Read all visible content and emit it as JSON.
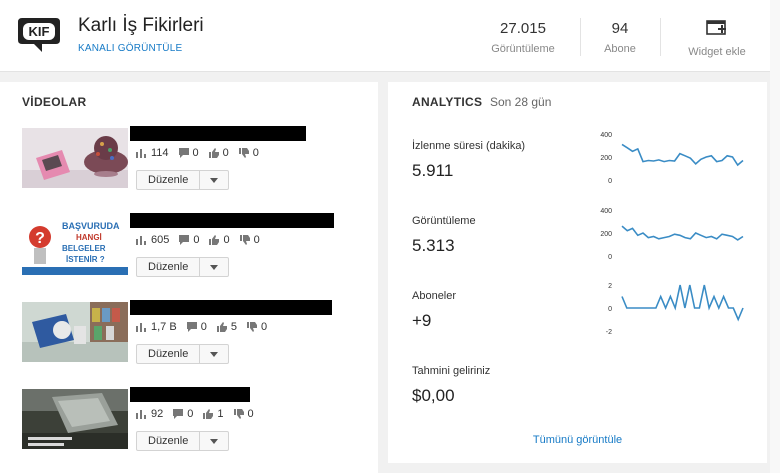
{
  "header": {
    "channel_name": "Karlı İş Fikirleri",
    "view_channel_link": "KANALI GÖRÜNTÜLE",
    "views": {
      "value": "27.015",
      "label": "Görüntüleme"
    },
    "subscribers": {
      "value": "94",
      "label": "Abone"
    },
    "widget_label": "Widget ekle"
  },
  "videos": {
    "title": "VİDEOLAR",
    "edit_label": "Düzenle",
    "items": [
      {
        "views": "114",
        "comments": "0",
        "likes": "0",
        "dislikes": "0"
      },
      {
        "views": "605",
        "comments": "0",
        "likes": "0",
        "dislikes": "0",
        "thumb_text": [
          "BAŞVURUDA",
          "HANGİ",
          "BELGELER",
          "İSTENİR ?"
        ]
      },
      {
        "views": "1,7 B",
        "comments": "0",
        "likes": "5",
        "dislikes": "0"
      },
      {
        "views": "92",
        "comments": "0",
        "likes": "1",
        "dislikes": "0"
      }
    ]
  },
  "analytics": {
    "title": "ANALYTICS",
    "period": "Son 28 gün",
    "see_all": "Tümünü görüntüle",
    "metrics": [
      {
        "label": "İzlenme süresi (dakika)",
        "value": "5.911",
        "ticks": [
          "400",
          "200",
          "0"
        ],
        "range": [
          0,
          400
        ],
        "series": [
          310,
          280,
          250,
          270,
          160,
          170,
          165,
          175,
          160,
          170,
          165,
          230,
          210,
          190,
          140,
          180,
          200,
          210,
          160,
          170,
          210,
          200,
          130,
          170
        ]
      },
      {
        "label": "Görüntüleme",
        "value": "5.313",
        "ticks": [
          "400",
          "200",
          "0"
        ],
        "range": [
          0,
          400
        ],
        "series": [
          260,
          220,
          240,
          180,
          200,
          160,
          170,
          150,
          160,
          170,
          190,
          180,
          160,
          150,
          200,
          180,
          160,
          170,
          150,
          190,
          180,
          170,
          140,
          170
        ]
      },
      {
        "label": "Aboneler",
        "value": "+9",
        "ticks": [
          "2",
          "0",
          "-2"
        ],
        "range": [
          -2,
          2
        ],
        "series": [
          1,
          0,
          0,
          0,
          0,
          0,
          0,
          0,
          1,
          0,
          1,
          0,
          2,
          0,
          2,
          0,
          0,
          2,
          0,
          1,
          0,
          1,
          0,
          0,
          -1,
          0
        ]
      },
      {
        "label": "Tahmini geliriniz",
        "value": "$0,00"
      }
    ]
  },
  "colors": {
    "accent": "#167ac6",
    "spark": "#3a8cc5"
  }
}
